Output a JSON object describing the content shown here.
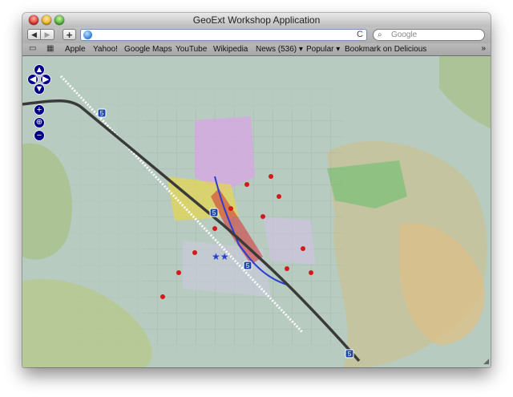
{
  "window": {
    "title": "GeoExt Workshop Application"
  },
  "toolbar": {
    "back_label": "◀",
    "forward_label": "▶",
    "add_label": "+",
    "address_value": "",
    "reload_label": "C",
    "search_placeholder": "Google"
  },
  "bookmarks": {
    "items": [
      "Apple",
      "Yahoo!",
      "Google Maps",
      "YouTube",
      "Wikipedia",
      "News (536) ▾",
      "Popular ▾",
      "Bookmark on Delicious"
    ],
    "more_label": "»"
  },
  "map": {
    "pan_up": "▲",
    "pan_down": "▼",
    "pan_left": "◀",
    "pan_right": "▶",
    "zoom_in": "+",
    "zoom_out": "−",
    "route_shields": [
      "5",
      "5",
      "5",
      "5"
    ]
  },
  "colors": {
    "terrain": "#b9ccc2",
    "highway": "#3a3a3a",
    "river": "#2a3fd1",
    "residential": "#c9a0d8",
    "commercial": "#e8d24a",
    "parks": "#6fbf6a",
    "markers": "#d21a1a",
    "controls": "#00008b"
  }
}
